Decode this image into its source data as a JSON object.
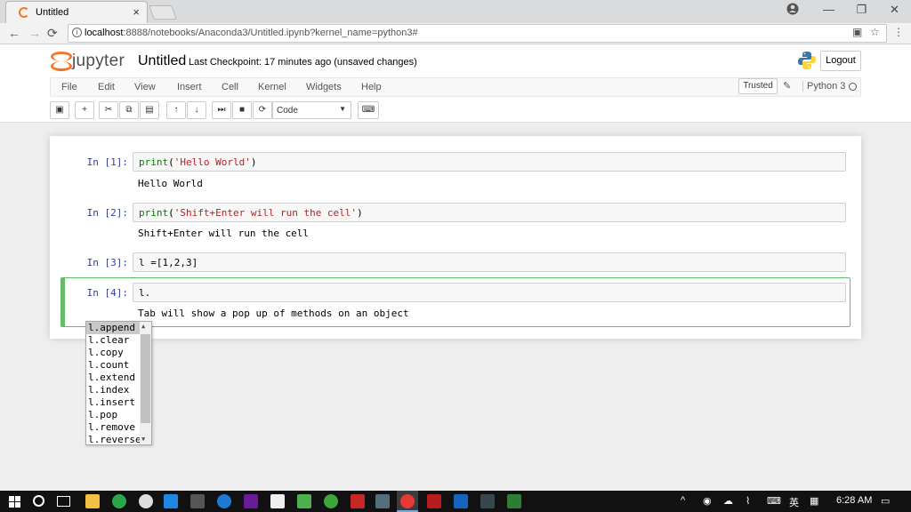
{
  "browser": {
    "tab_title": "Untitled",
    "tab_close": "×",
    "url_host": "localhost",
    "url_path": ":8888/notebooks/Anaconda3/Untitled.ipynb?kernel_name=python3#",
    "win_min": "—",
    "win_restore": "❐",
    "win_close": "✕"
  },
  "jupyter": {
    "logo_text": "jupyter",
    "notebook_name": "Untitled",
    "checkpoint": "Last Checkpoint: 17 minutes ago (unsaved changes)",
    "logout_label": "Logout",
    "menu": [
      "File",
      "Edit",
      "View",
      "Insert",
      "Cell",
      "Kernel",
      "Widgets",
      "Help"
    ],
    "trusted_label": "Trusted",
    "kernel_name": "Python 3",
    "cell_type": "Code"
  },
  "cells": [
    {
      "prompt": "In [1]:",
      "code_fn": "print",
      "code_open": "(",
      "code_str": "'Hello World'",
      "code_close": ")",
      "output": "Hello World"
    },
    {
      "prompt": "In [2]:",
      "code_fn": "print",
      "code_open": "(",
      "code_str": "'Shift+Enter will run the cell'",
      "code_close": ")",
      "output": "Shift+Enter will run the cell"
    },
    {
      "prompt": "In [3]:",
      "code": "l =[1,2,3]"
    },
    {
      "prompt": "In [4]:",
      "code": "l.",
      "output": "Tab will show a pop up of methods on an object"
    }
  ],
  "completions": [
    "l.append",
    "l.clear",
    "l.copy",
    "l.count",
    "l.extend",
    "l.index",
    "l.insert",
    "l.pop",
    "l.remove",
    "l.reverse"
  ],
  "taskbar": {
    "lang": "英",
    "time": "6:28 AM"
  }
}
